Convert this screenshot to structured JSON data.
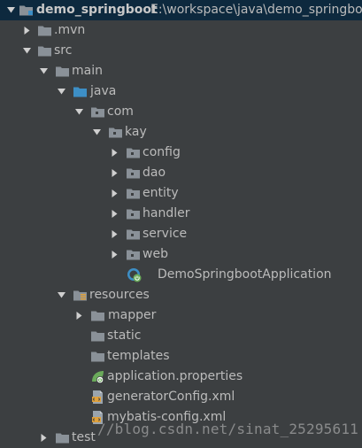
{
  "project": {
    "name": "demo_springboot",
    "path": "E:\\workspace\\java\\demo_springboot"
  },
  "tree": [
    {
      "label": "demo_springboot",
      "expanded": true,
      "icon": "module-folder-icon",
      "bold": true
    },
    {
      "label": ".mvn",
      "expanded": false,
      "icon": "folder-icon"
    },
    {
      "label": "src",
      "expanded": true,
      "icon": "folder-icon"
    },
    {
      "label": "main",
      "expanded": true,
      "icon": "folder-icon"
    },
    {
      "label": "java",
      "expanded": true,
      "icon": "source-root-folder-icon"
    },
    {
      "label": "com",
      "expanded": true,
      "icon": "package-folder-icon"
    },
    {
      "label": "kay",
      "expanded": true,
      "icon": "package-folder-icon"
    },
    {
      "label": "config",
      "expanded": false,
      "icon": "package-folder-icon"
    },
    {
      "label": "dao",
      "expanded": false,
      "icon": "package-folder-icon"
    },
    {
      "label": "entity",
      "expanded": false,
      "icon": "package-folder-icon"
    },
    {
      "label": "handler",
      "expanded": false,
      "icon": "package-folder-icon"
    },
    {
      "label": "service",
      "expanded": false,
      "icon": "package-folder-icon"
    },
    {
      "label": "web",
      "expanded": false,
      "icon": "package-folder-icon"
    },
    {
      "label": "DemoSpringbootApplication",
      "icon": "spring-boot-class-icon"
    },
    {
      "label": "resources",
      "expanded": true,
      "icon": "resources-root-folder-icon"
    },
    {
      "label": "mapper",
      "expanded": false,
      "icon": "folder-icon"
    },
    {
      "label": "static",
      "icon": "folder-icon"
    },
    {
      "label": "templates",
      "icon": "folder-icon"
    },
    {
      "label": "application.properties",
      "icon": "spring-properties-icon"
    },
    {
      "label": "generatorConfig.xml",
      "icon": "xml-file-icon"
    },
    {
      "label": "mybatis-config.xml",
      "icon": "xml-file-icon"
    },
    {
      "label": "test",
      "expanded": false,
      "icon": "folder-icon"
    }
  ],
  "watermark": "//blog.csdn.net/sinat_25295611",
  "colors": {
    "background": "#3c3f41",
    "selection": "#0d293e",
    "text": "#bbbbbb",
    "folder": "#8a9198",
    "source_root": "#3d8fc6",
    "spring_green": "#6aaa5a",
    "xml_orange": "#e0a13b"
  }
}
